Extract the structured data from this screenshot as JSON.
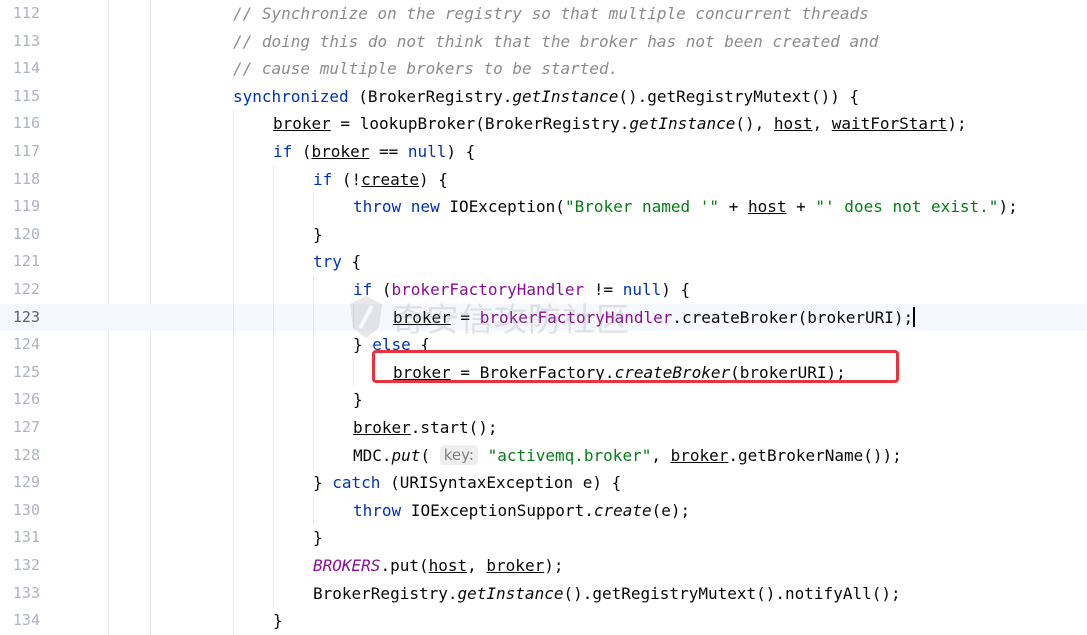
{
  "editor": {
    "lines": [
      {
        "num": "112",
        "tokens": [
          {
            "t": "// Synchronize on the registry so that multiple concurrent threads",
            "c": "cm"
          }
        ]
      },
      {
        "num": "113",
        "tokens": [
          {
            "t": "// doing this do not think that the broker has not been created and",
            "c": "cm"
          }
        ]
      },
      {
        "num": "114",
        "tokens": [
          {
            "t": "// cause multiple brokers to be started.",
            "c": "cm"
          }
        ]
      },
      {
        "num": "115",
        "tokens": [
          {
            "t": "synchronized",
            "c": "kw"
          },
          {
            "t": " (BrokerRegistry."
          },
          {
            "t": "getInstance",
            "c": "it"
          },
          {
            "t": "().getRegistryMutext()) {"
          }
        ]
      },
      {
        "num": "116",
        "tokens": [
          {
            "t": "broker",
            "c": "ul"
          },
          {
            "t": " = lookupBroker(BrokerRegistry."
          },
          {
            "t": "getInstance",
            "c": "it"
          },
          {
            "t": "(), "
          },
          {
            "t": "host",
            "c": "ul"
          },
          {
            "t": ", "
          },
          {
            "t": "waitForStart",
            "c": "ul"
          },
          {
            "t": ");"
          }
        ]
      },
      {
        "num": "117",
        "tokens": [
          {
            "t": "if",
            "c": "kw"
          },
          {
            "t": " ("
          },
          {
            "t": "broker",
            "c": "ul"
          },
          {
            "t": " == "
          },
          {
            "t": "null",
            "c": "kw"
          },
          {
            "t": ") {"
          }
        ]
      },
      {
        "num": "118",
        "tokens": [
          {
            "t": "if",
            "c": "kw"
          },
          {
            "t": " (!"
          },
          {
            "t": "create",
            "c": "ul"
          },
          {
            "t": ") {"
          }
        ]
      },
      {
        "num": "119",
        "tokens": [
          {
            "t": "throw new",
            "c": "kw"
          },
          {
            "t": " IOException("
          },
          {
            "t": "\"Broker named '\"",
            "c": "st"
          },
          {
            "t": " + "
          },
          {
            "t": "host",
            "c": "ul"
          },
          {
            "t": " + "
          },
          {
            "t": "\"' does not exist.\"",
            "c": "st"
          },
          {
            "t": ");"
          }
        ]
      },
      {
        "num": "120",
        "tokens": [
          {
            "t": "}"
          }
        ]
      },
      {
        "num": "121",
        "tokens": [
          {
            "t": "try",
            "c": "kw"
          },
          {
            "t": " {"
          }
        ]
      },
      {
        "num": "122",
        "tokens": [
          {
            "t": "if",
            "c": "kw"
          },
          {
            "t": " ("
          },
          {
            "t": "brokerFactoryHandler",
            "c": "fi"
          },
          {
            "t": " != "
          },
          {
            "t": "null",
            "c": "kw"
          },
          {
            "t": ") {"
          }
        ]
      },
      {
        "num": "123",
        "tokens": [
          {
            "t": "broker",
            "c": "ul"
          },
          {
            "t": " = "
          },
          {
            "t": "brokerFactoryHandler",
            "c": "fi"
          },
          {
            "t": ".createBroker(brokerURI);"
          }
        ]
      },
      {
        "num": "124",
        "tokens": [
          {
            "t": "} "
          },
          {
            "t": "else",
            "c": "kw"
          },
          {
            "t": " {"
          }
        ]
      },
      {
        "num": "125",
        "tokens": [
          {
            "t": "broker",
            "c": "ul"
          },
          {
            "t": " = BrokerFactory."
          },
          {
            "t": "createBroker",
            "c": "it"
          },
          {
            "t": "(brokerURI);"
          }
        ]
      },
      {
        "num": "126",
        "tokens": [
          {
            "t": "}"
          }
        ]
      },
      {
        "num": "127",
        "tokens": [
          {
            "t": "broker",
            "c": "ul"
          },
          {
            "t": ".start();"
          }
        ]
      },
      {
        "num": "128",
        "tokens": [
          {
            "t": "MDC."
          },
          {
            "t": "put",
            "c": "it"
          },
          {
            "t": "( "
          },
          {
            "t": "key:",
            "c": "hint"
          },
          {
            "t": " "
          },
          {
            "t": "\"activemq.broker\"",
            "c": "st"
          },
          {
            "t": ", "
          },
          {
            "t": "broker",
            "c": "ul"
          },
          {
            "t": ".getBrokerName());"
          }
        ]
      },
      {
        "num": "129",
        "tokens": [
          {
            "t": "} "
          },
          {
            "t": "catch",
            "c": "kw"
          },
          {
            "t": " (URISyntaxException e) {"
          }
        ]
      },
      {
        "num": "130",
        "tokens": [
          {
            "t": "throw",
            "c": "kw"
          },
          {
            "t": " IOExceptionSupport."
          },
          {
            "t": "create",
            "c": "it"
          },
          {
            "t": "(e);"
          }
        ]
      },
      {
        "num": "131",
        "tokens": [
          {
            "t": "}"
          }
        ]
      },
      {
        "num": "132",
        "tokens": [
          {
            "t": "BROKERS",
            "c": "sfi"
          },
          {
            "t": ".put("
          },
          {
            "t": "host",
            "c": "ul"
          },
          {
            "t": ", "
          },
          {
            "t": "broker",
            "c": "ul"
          },
          {
            "t": ");"
          }
        ]
      },
      {
        "num": "133",
        "tokens": [
          {
            "t": "BrokerRegistry."
          },
          {
            "t": "getInstance",
            "c": "it"
          },
          {
            "t": "().getRegistryMutext().notifyAll();"
          }
        ]
      },
      {
        "num": "134",
        "tokens": [
          {
            "t": "}"
          }
        ]
      }
    ],
    "current_line": "123"
  },
  "watermark": {
    "text": "奇安信攻防社区",
    "icon": "shield-logo-icon"
  },
  "colors": {
    "highlight_box": "#e8323c",
    "keyword": "#0033b3",
    "string": "#067d17",
    "field": "#871094",
    "comment": "#8c8c8c"
  }
}
